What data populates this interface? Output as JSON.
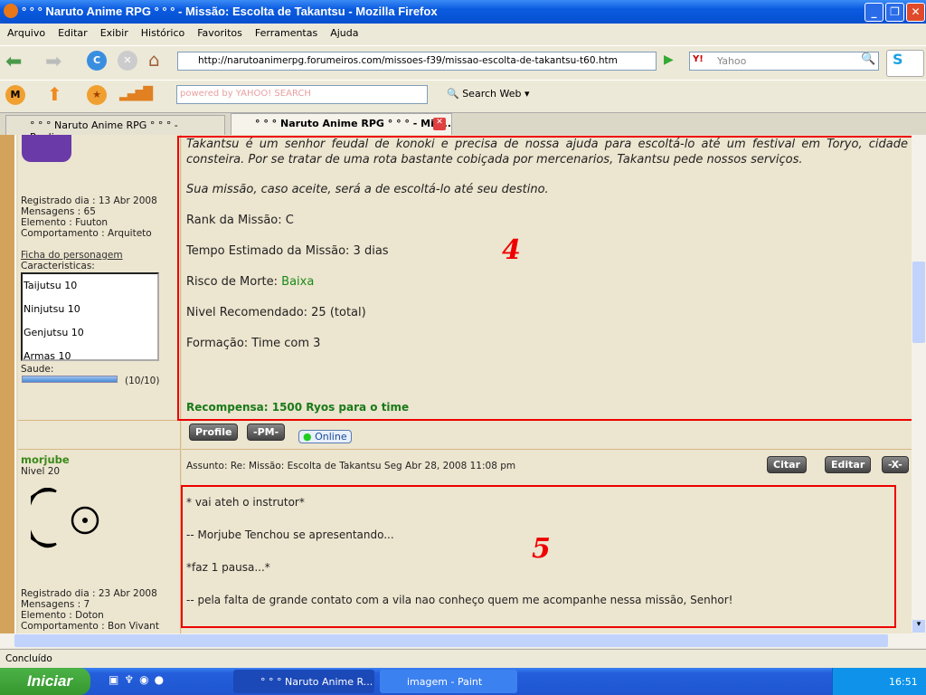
{
  "window": {
    "title": "° ° ° Naruto Anime RPG ° ° ° - Missão: Escolta de Takantsu - Mozilla Firefox"
  },
  "menu": [
    "Arquivo",
    "Editar",
    "Exibir",
    "Histórico",
    "Favoritos",
    "Ferramentas",
    "Ajuda"
  ],
  "navbar": {
    "url": "http://narutoanimerpg.forumeiros.com/missoes-f39/missao-escolta-de-takantsu-t60.htm",
    "search_placeholder": "Yahoo"
  },
  "yahoobar": {
    "search_placeholder": "powered by YAHOO! SEARCH",
    "search_web": "Search Web"
  },
  "tabs": [
    {
      "label": "° ° ° Naruto Anime RPG ° ° ° - Realiza...",
      "active": false
    },
    {
      "label": "° ° ° Naruto Anime RPG ° ° ° - Mis...",
      "active": true
    }
  ],
  "post1": {
    "user_info": [
      "Registrado dia : 13 Abr 2008",
      "Mensagens : 65",
      "Elemento : Fuuton",
      "Comportamento : Arquiteto"
    ],
    "sheet_link": "Ficha do personagem",
    "characteristics_label": "Caracteristicas:",
    "characteristics": [
      "Taijutsu 10",
      "Ninjutsu 10",
      "Genjutsu 10",
      "Armas 10"
    ],
    "health_label": "Saude:",
    "health_text": "(10/10)",
    "health_fraction": 1.0,
    "intro": "Takantsu é um senhor feudal de konoki e precisa de nossa ajuda para escoltá-lo até um festival em Toryo, cidade consteira. Por se tratar de uma rota bastante cobiçada por mercenarios, Takantsu pede nossos serviços.",
    "mission": "Sua missão, caso aceite, será a de escoltá-lo até seu destino.",
    "rank": "Rank da Missão: C",
    "time": "Tempo Estimado da Missão: 3 dias",
    "risk_label": "Risco de Morte: ",
    "risk_value": "Baixa",
    "level": "Nivel Recomendado: 25 (total)",
    "formation": "Formação: Time com 3",
    "reward": "Recompensa: 1500 Ryos para o time",
    "annotation": "4",
    "buttons": {
      "profile": "Profile",
      "pm": "-PM-",
      "online": "Online"
    }
  },
  "post2": {
    "username": "morjube",
    "level": "Nivel 20",
    "subject": "Assunto: Re: Missão: Escolta de Takantsu   Seg Abr 28, 2008 11:08 pm",
    "buttons": {
      "quote": "Citar",
      "edit": "Editar",
      "delete": "-X-"
    },
    "user_info": [
      "Registrado dia : 23 Abr 2008",
      "Mensagens : 7",
      "Elemento : Doton",
      "Comportamento : Bon Vivant"
    ],
    "lines": [
      "* vai ateh o instrutor*",
      "-- Morjube Tenchou se apresentando...",
      "*faz 1 pausa...*",
      "-- pela falta de grande contato com a vila nao conheço quem me acompanhe nessa missão, Senhor!"
    ],
    "annotation": "5"
  },
  "status": "Concluído",
  "taskbar": {
    "start": "Iniciar",
    "tasks": [
      "° ° ° Naruto Anime R...",
      "imagem - Paint"
    ],
    "clock": "16:51"
  },
  "colors": {
    "accent_red": "#e00000",
    "green_text": "#1a8a1a",
    "titlebar": "#0a5ae0"
  }
}
